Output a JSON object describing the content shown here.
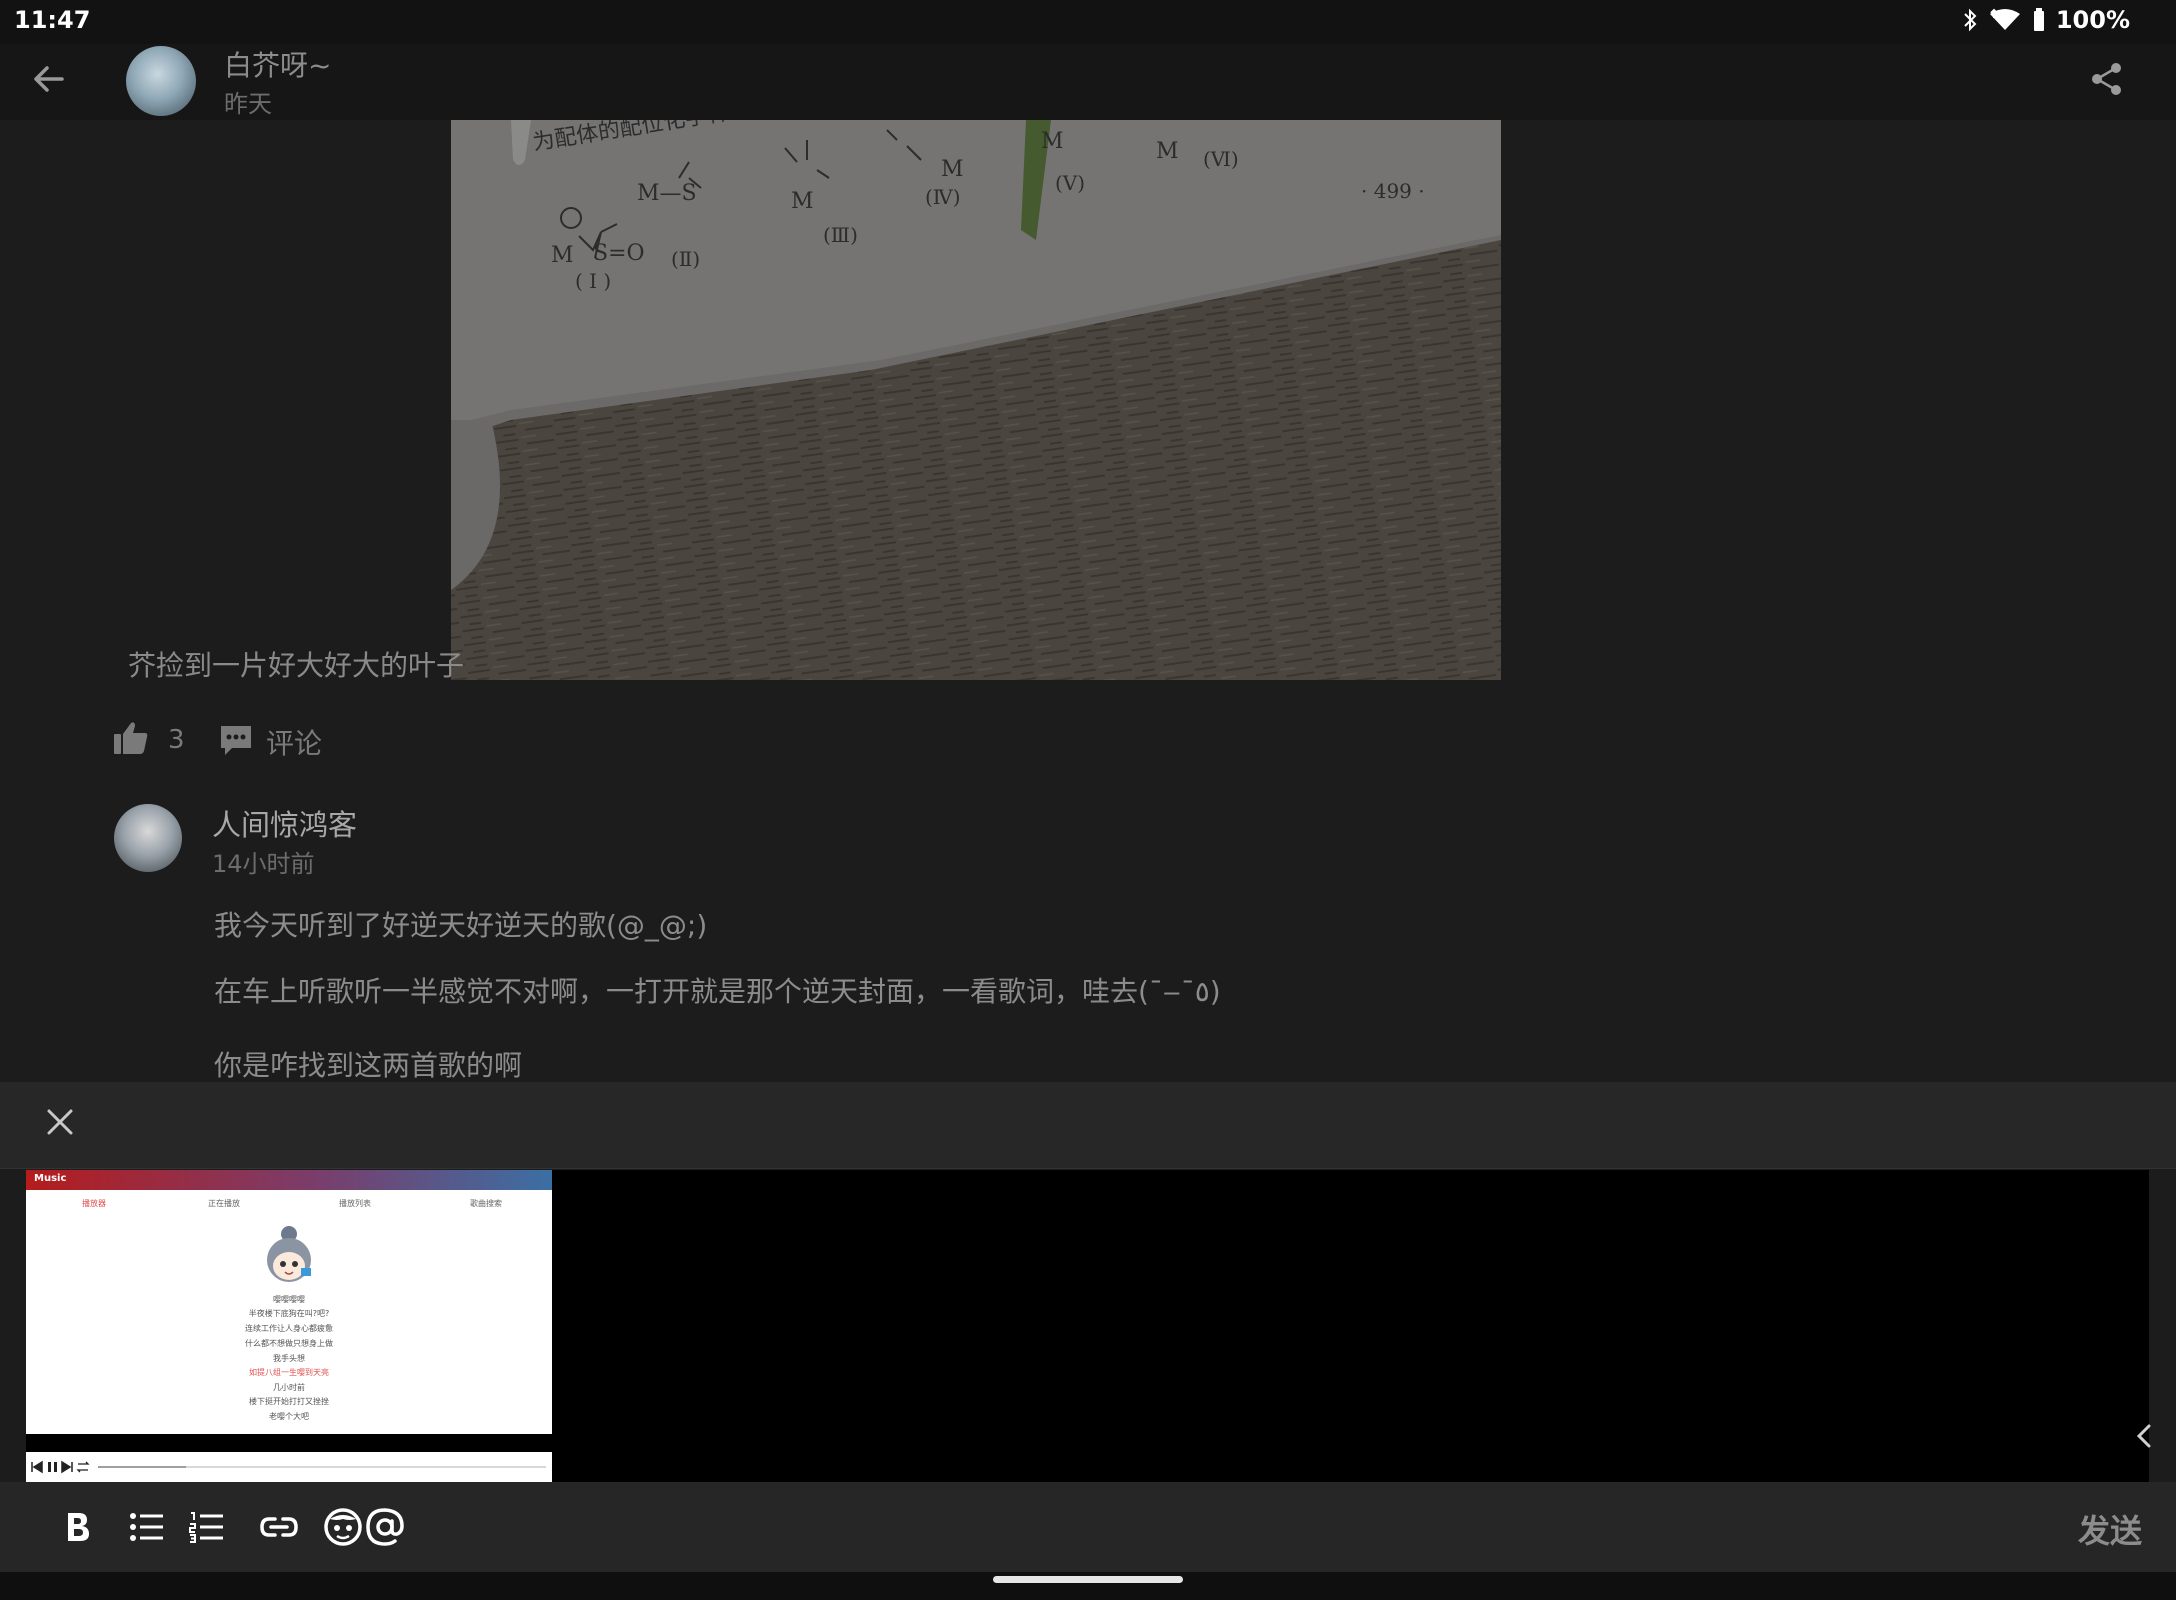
{
  "status_bar": {
    "time": "11:47",
    "battery": "100%"
  },
  "post": {
    "author": "白芥呀~",
    "time": "昨天",
    "caption": "芥捡到一片好大好大的叶子",
    "likes": "3",
    "comment_label": "评论",
    "photo_text": {
      "book_line": "为配体的配位化学种",
      "m": "M",
      "s_o": "S=O",
      "m_s": "M—S",
      "labels": [
        "( I )",
        "(Ⅱ)",
        "(Ⅲ)",
        "(Ⅳ)",
        "(Ⅴ)",
        "(Ⅵ)"
      ],
      "page": "· 499 ·"
    }
  },
  "comment": {
    "author": "人间惊鸿客",
    "time": "14小时前",
    "lines": [
      "我今天听到了好逆天好逆天的歌(@_@;)",
      "在车上听歌听一半感觉不对啊，一打开就是那个逆天封面，一看歌词，哇去(¯‒¯٥)",
      "你是咋找到这两首歌的啊"
    ]
  },
  "reply": {
    "send_label": "发送",
    "attachment": {
      "app_title": "Music",
      "tabs": [
        "播放器",
        "正在播放",
        "播放列表",
        "歌曲搜索"
      ],
      "lyrics": [
        "嘤嘤嘤嘤",
        "半夜楼下底狗在叫?吧?",
        "连续工作让人身心都疲惫",
        "什么都不想做只想身上做",
        "我手头想",
        "如提八组一生嘤到天亮",
        "几小时前",
        "楼下挺开始打打又挫挫",
        "老嘤个大吧"
      ]
    }
  },
  "icons": {
    "back": "arrow-left-icon",
    "share": "share-icon",
    "like": "thumb-up-icon",
    "comment": "comment-icon",
    "close": "close-icon",
    "collapse": "chevron-left-icon",
    "bold": "bold-icon",
    "bullet_list": "bullet-list-icon",
    "numbered_list": "numbered-list-icon",
    "link": "link-icon",
    "emoji": "emoji-icon",
    "mention": "at-mention-icon"
  },
  "colors": {
    "background": "#1c1c1c",
    "panel": "#272727",
    "text_muted": "#8c8c8c"
  }
}
